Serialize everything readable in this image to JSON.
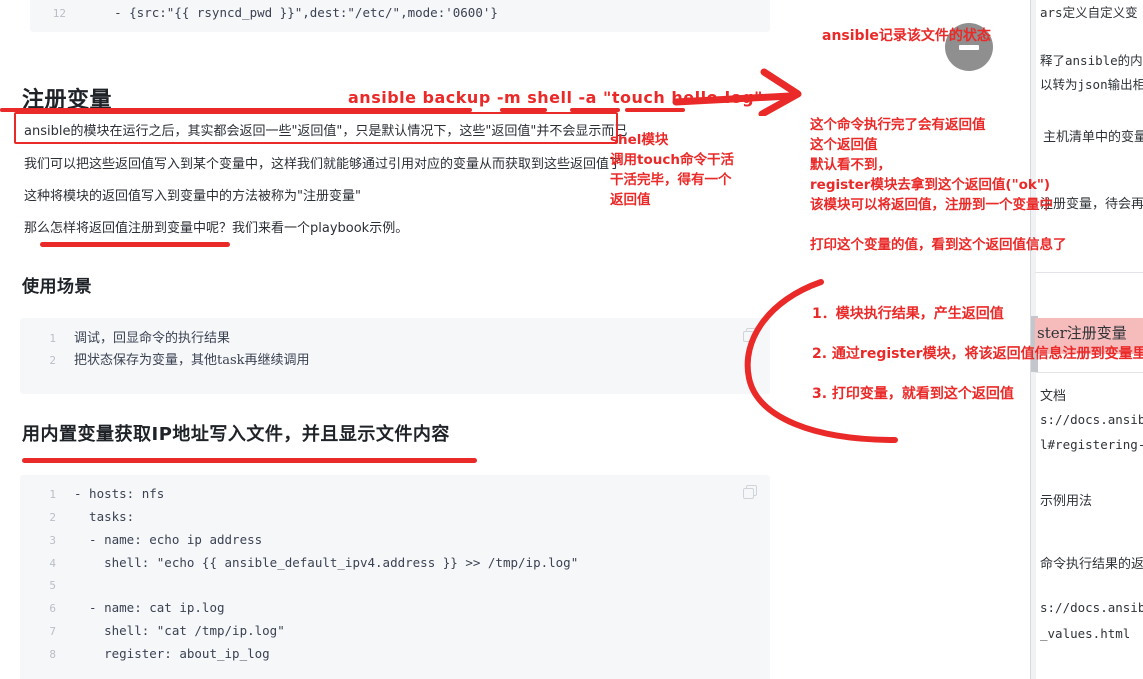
{
  "document": {
    "top_code_block": {
      "lines": [
        {
          "no": "12",
          "text": "    - {src:\"{{ rsyncd_pwd }}\",dest:\"/etc/\",mode:'0600'}"
        }
      ]
    },
    "heading_register_variable": "注册变量",
    "paragraphs": [
      "ansible的模块在运行之后，其实都会返回一些\"返回值\"，只是默认情况下，这些\"返回值\"并不会显示而已",
      "我们可以把这些返回值写入到某个变量中，这样我们就能够通过引用对应的变量从而获取到这些返回值了",
      "这种将模块的返回值写入到变量中的方法被称为\"注册变量\"",
      "那么怎样将返回值注册到变量中呢？我们来看一个playbook示例。"
    ],
    "heading_use_cases": "使用场景",
    "use_case_code_block": {
      "lines": [
        {
          "no": "1",
          "text": "调试，回显命令的执行结果"
        },
        {
          "no": "2",
          "text": "把状态保存为变量，其他task再继续调用"
        }
      ]
    },
    "heading_builtin_ip": "用内置变量获取IP地址写入文件，并且显示文件内容",
    "playbook_code_block": {
      "lines": [
        {
          "no": "1",
          "text": "- hosts: nfs"
        },
        {
          "no": "2",
          "text": "  tasks:"
        },
        {
          "no": "3",
          "text": "  - name: echo ip address"
        },
        {
          "no": "4",
          "text": "    shell: \"echo {{ ansible_default_ipv4.address }} >> /tmp/ip.log\""
        },
        {
          "no": "5",
          "text": ""
        },
        {
          "no": "6",
          "text": "  - name: cat ip.log"
        },
        {
          "no": "7",
          "text": "    shell: \"cat /tmp/ip.log\""
        },
        {
          "no": "8",
          "text": "    register: about_ip_log"
        }
      ]
    }
  },
  "annotations": {
    "command_line": "ansible  backup  -m shell  -a \"touch  hello.log\"",
    "file_state_note": "ansible记录该文件的状态",
    "shell_module_block": [
      "shel模块",
      "调用touch命令干活",
      "干活完毕，得有一个",
      "返回值"
    ],
    "return_value_block": [
      "这个命令执行完了会有返回值",
      "这个返回值",
      "默认看不到，",
      "register模块去拿到这个返回值(\"ok\")",
      "该模块可以将返回值，注册到一个变量中"
    ],
    "print_note": "打印这个变量的值，看到这个返回值信息了",
    "numbered_steps": [
      "1．模块执行结果，产生返回值",
      "2. 通过register模块，将该返回值信息注册到变量里",
      "3. 打印变量，就看到这个返回值"
    ],
    "accent_color": "#ea2a28"
  },
  "right_panel": {
    "lines": [
      "ars定义自定义变",
      "释了ansible的内",
      "以转为json输出相",
      "主机清单中的变量",
      "注册变量，待会再"
    ],
    "highlight_heading": "ster注册变量",
    "doc_lines": [
      "文档",
      "s://docs.ansib",
      "l#registering-",
      "示例用法",
      "命令执行结果的返",
      "s://docs.ansib",
      "_values.html"
    ]
  },
  "fab": {
    "icon": "minimize-icon",
    "color": "#8f8f8f"
  }
}
